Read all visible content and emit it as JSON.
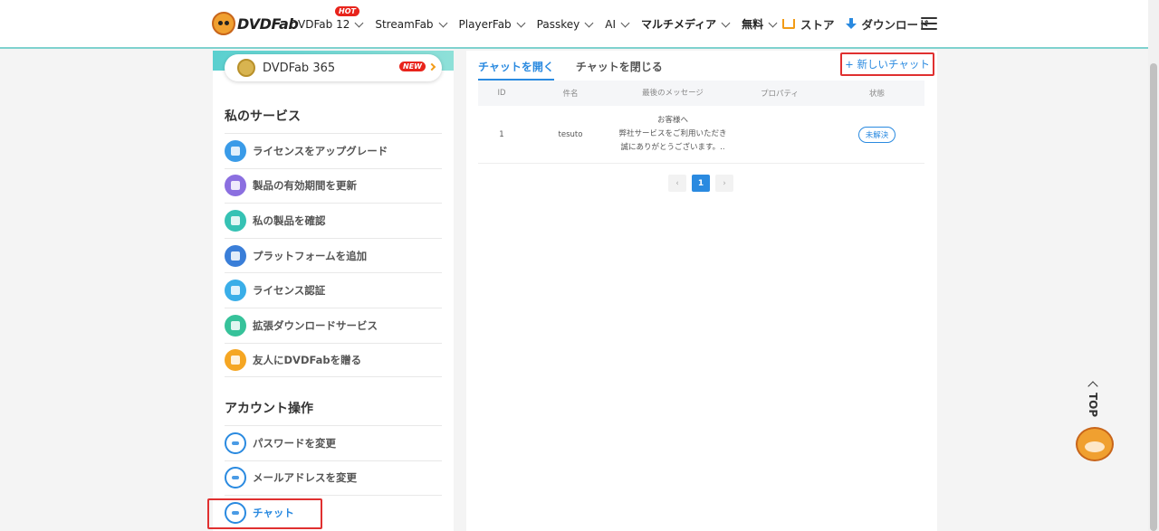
{
  "header": {
    "logo_text": "DVDFab",
    "nav": [
      {
        "label": "DVDFab 12",
        "badge": "HOT"
      },
      {
        "label": "StreamFab"
      },
      {
        "label": "PlayerFab"
      },
      {
        "label": "Passkey"
      },
      {
        "label": "AI"
      },
      {
        "label": "マルチメディア"
      },
      {
        "label": "無料"
      }
    ],
    "store_label": "ストア",
    "download_label": "ダウンロード"
  },
  "sidebar": {
    "promo_label": "DVDFab 365",
    "promo_badge": "NEW",
    "services_title": "私のサービス",
    "services": [
      {
        "label": "ライセンスをアップグレード",
        "icon": "upgrade-icon",
        "color": "#3a9be8"
      },
      {
        "label": "製品の有効期間を更新",
        "icon": "renew-icon",
        "color": "#8b6fe0"
      },
      {
        "label": "私の製品を確認",
        "icon": "products-icon",
        "color": "#36c2b4"
      },
      {
        "label": "プラットフォームを追加",
        "icon": "platform-icon",
        "color": "#3a7ed8"
      },
      {
        "label": "ライセンス認証",
        "icon": "license-cloud-icon",
        "color": "#3aaee8"
      },
      {
        "label": "拡張ダウンロードサービス",
        "icon": "download-service-icon",
        "color": "#36c29a"
      },
      {
        "label": "友人にDVDFabを贈る",
        "icon": "gift-icon",
        "color": "#f5a623"
      }
    ],
    "account_title": "アカウント操作",
    "account": [
      {
        "label": "パスワードを変更",
        "icon": "key-icon"
      },
      {
        "label": "メールアドレスを変更",
        "icon": "email-icon"
      },
      {
        "label": "チャット",
        "icon": "chat-icon"
      }
    ]
  },
  "main": {
    "tabs": [
      "チャットを開く",
      "チャットを閉じる"
    ],
    "new_chat_label": "+ 新しいチャット",
    "table": {
      "headers": [
        "ID",
        "件名",
        "最後のメッセージ",
        "プロパティ",
        "状態"
      ],
      "rows": [
        {
          "id": "1",
          "subject": "tesuto",
          "message_lines": [
            "お客様へ",
            "弊社サービスをご利用いただき",
            "誠にありがとうございます。.."
          ],
          "property": "",
          "status": "未解決"
        }
      ]
    },
    "pagination": {
      "prev": "‹",
      "current": "1",
      "next": "›"
    }
  },
  "top_button": {
    "label": "TOP"
  }
}
